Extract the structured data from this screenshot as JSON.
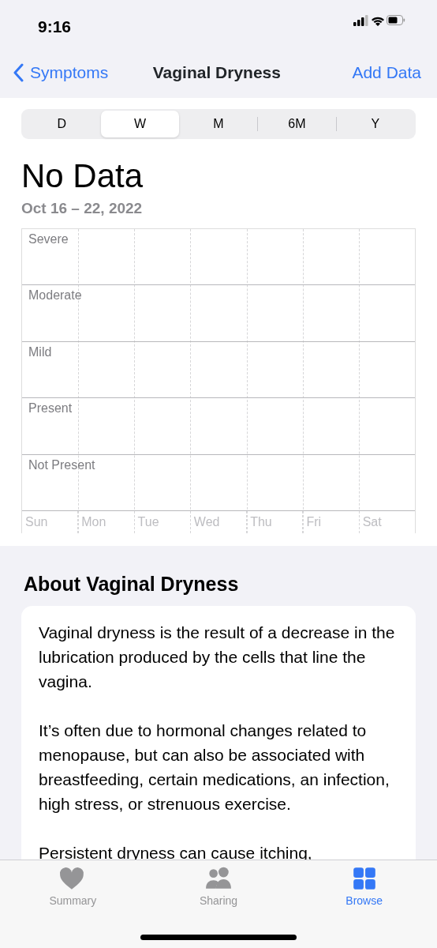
{
  "status_bar": {
    "time": "9:16"
  },
  "nav": {
    "back": "Symptoms",
    "title": "Vaginal Dryness",
    "action": "Add Data"
  },
  "ranges": [
    {
      "label": "D",
      "selected": false
    },
    {
      "label": "W",
      "selected": true
    },
    {
      "label": "M",
      "selected": false
    },
    {
      "label": "6M",
      "selected": false
    },
    {
      "label": "Y",
      "selected": false
    }
  ],
  "summary": {
    "value": "No Data",
    "date_range": "Oct 16 – 22, 2022"
  },
  "chart": {
    "levels": [
      "Severe",
      "Moderate",
      "Mild",
      "Present",
      "Not Present"
    ],
    "days": [
      "Sun",
      "Mon",
      "Tue",
      "Wed",
      "Thu",
      "Fri",
      "Sat"
    ]
  },
  "about": {
    "heading": "About Vaginal Dryness",
    "paragraphs": [
      "Vaginal dryness is the result of a decrease in the lubrication produced by the cells that line the vagina.",
      "It’s often due to hormonal changes related to menopause, but can also be associated with breastfeeding, certain medications, an infection, high stress, or strenuous exercise.",
      "Persistent dryness can cause itching,"
    ]
  },
  "tab_bar": [
    {
      "label": "Summary",
      "kind": "heart",
      "selected": false
    },
    {
      "label": "Sharing",
      "kind": "people",
      "selected": false
    },
    {
      "label": "Browse",
      "kind": "grid",
      "selected": true
    }
  ]
}
